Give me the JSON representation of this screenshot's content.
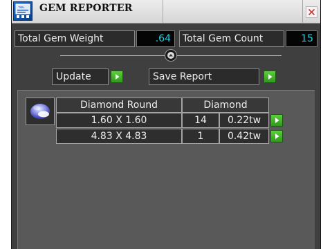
{
  "window": {
    "title": "GEM REPORTER"
  },
  "stats": {
    "weight_label": "Total Gem Weight",
    "weight_value": ".64",
    "count_label": "Total Gem Count",
    "count_value": "15"
  },
  "buttons": {
    "update_label": "Update",
    "save_label": "Save Report"
  },
  "table": {
    "headers": [
      "Diamond Round",
      "Diamond"
    ],
    "rows": [
      {
        "size": "1.60 X 1.60",
        "count": "14",
        "weight": "0.22tw"
      },
      {
        "size": "4.83 X 4.83",
        "count": "1",
        "weight": "0.42tw"
      }
    ]
  },
  "icons": {
    "app": "gem-reporter-app-icon",
    "close": "close-icon",
    "splitter": "chevron-up-icon",
    "go": "play-arrow-icon",
    "gem": "diamond-round-icon"
  },
  "colors": {
    "accent_value": "#1fd2e6",
    "go_green": "#3fb52a",
    "panel_bg": "#595959",
    "window_bg": "#3f3f3f"
  }
}
